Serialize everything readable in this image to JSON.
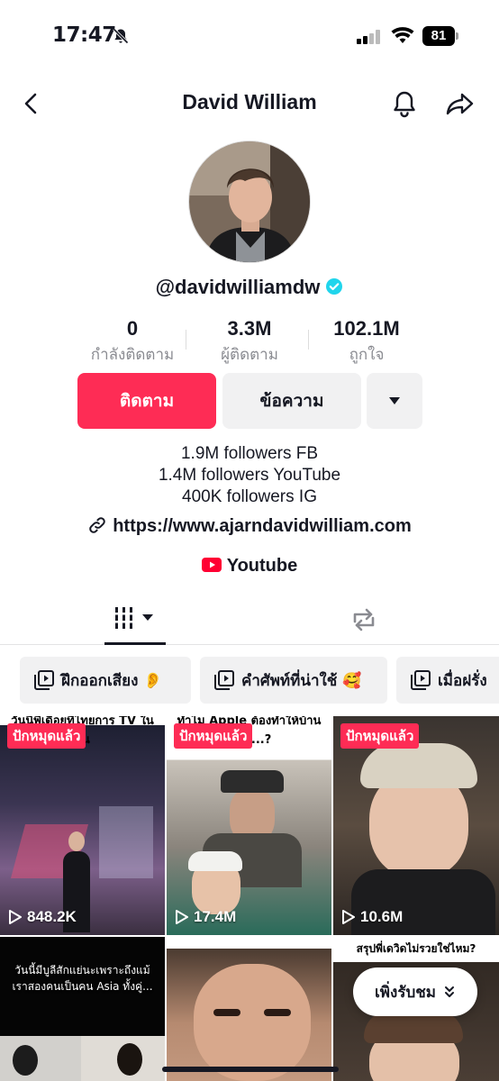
{
  "status_bar": {
    "time": "17:47",
    "battery": "81"
  },
  "header": {
    "title": "David William"
  },
  "profile": {
    "handle": "@davidwilliamdw",
    "stats": [
      {
        "value": "0",
        "label": "กำลังติดตาม"
      },
      {
        "value": "3.3M",
        "label": "ผู้ติดตาม"
      },
      {
        "value": "102.1M",
        "label": "ถูกใจ"
      }
    ],
    "follow_label": "ติดตาม",
    "message_label": "ข้อความ",
    "bio_lines": [
      "1.9M followers FB",
      "1.4M followers YouTube",
      "400K followers IG"
    ],
    "link": "https://www.ajarndavidwilliam.com",
    "youtube_label": "Youtube"
  },
  "playlists": [
    {
      "label": "ฝึกออกเสียง 👂"
    },
    {
      "label": "คำศัพท์ที่น่าใช้ 🥰"
    },
    {
      "label": "เมื่อฝรั่ง"
    }
  ],
  "videos": [
    {
      "pinned": "ปักหมุดแล้ว",
      "views": "848.2K",
      "caption": "วันนี้พี่เดือยที่ไทยการ TV ในผัน"
    },
    {
      "pinned": "ปักหมุดแล้ว",
      "views": "17.4M",
      "caption": "ทำไม Apple ต้องทำให้บ้านเราดู...?"
    },
    {
      "pinned": "ปักหมุดแล้ว",
      "views": "10.6M",
      "caption": ""
    },
    {
      "pinned": "",
      "views": "",
      "caption": "วันนี้มีบูลีสักแย่นะเพราะถึงแม้เราสองคนเป็นคน Asia ทั้งคู่..."
    },
    {
      "pinned": "",
      "views": "",
      "caption": ""
    },
    {
      "pinned": "",
      "views": "",
      "caption": "สรุปพี่เดวิดไม่รวยใช่ไหม?"
    }
  ],
  "watch_pill_label": "เพิ่งรับชม",
  "colors": {
    "accent": "#fe2c55",
    "button_grey": "#f1f1f2",
    "verified": "#20d5ec"
  }
}
